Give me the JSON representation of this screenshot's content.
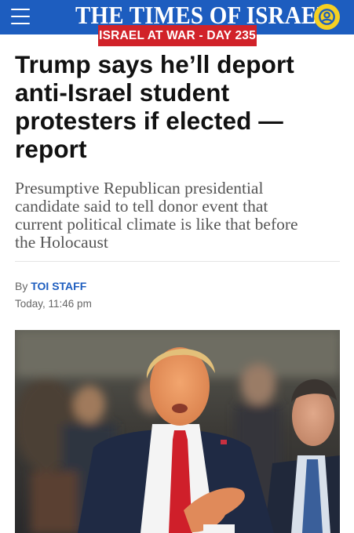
{
  "header": {
    "logo_text": "THE TIMES OF ISRAEL",
    "menu_icon": "hamburger-menu-icon",
    "user_icon": "user-account-icon",
    "brand_color": "#1d5dbf",
    "user_button_color": "#f5d023"
  },
  "banner": {
    "label": "ISRAEL AT WAR - DAY 235",
    "color": "#d12229"
  },
  "article": {
    "headline_lines": [
      "Trump says he’ll deport",
      "anti-Israel student",
      "protesters if elected —",
      "report"
    ],
    "subhead_lines": [
      "Presumptive Republican presidential",
      "candidate said to tell donor event that",
      "current political climate is like that before",
      "the Holocaust"
    ],
    "byline_prefix": "By",
    "author": "TOI STAFF",
    "timestamp": "Today, 11:46 pm",
    "photo_description_icon": "article-photo"
  }
}
